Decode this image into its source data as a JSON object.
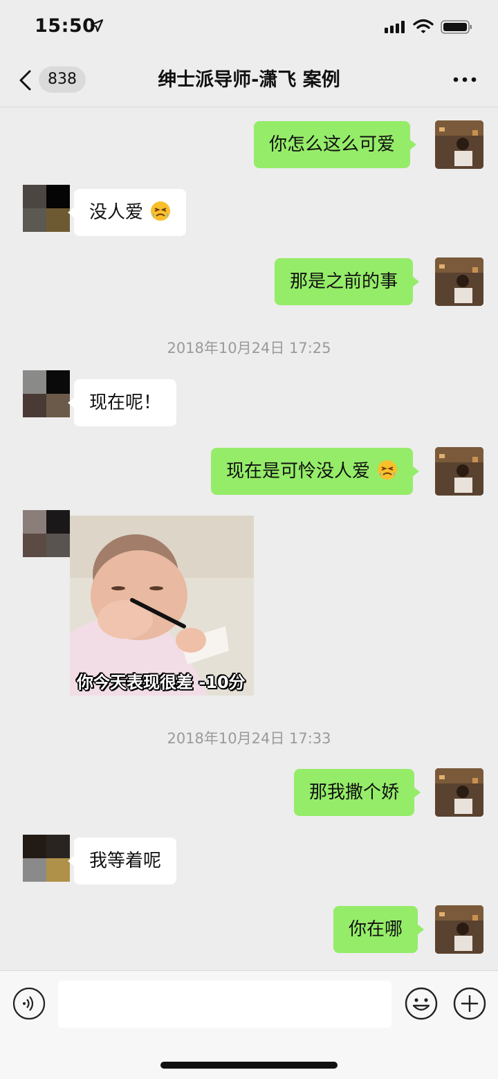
{
  "status_bar": {
    "time": "15:50"
  },
  "header": {
    "back_count": "838",
    "title": "绅士派导师-潇飞 案例"
  },
  "messages": [
    {
      "type": "text",
      "from": "me",
      "text": "你怎么这么可爱"
    },
    {
      "type": "text",
      "from": "other",
      "text": "没人爱",
      "emoji": "crying-face"
    },
    {
      "type": "text",
      "from": "me",
      "text": "那是之前的事"
    },
    {
      "type": "time",
      "text": "2018年10月24日 17:25"
    },
    {
      "type": "text",
      "from": "other",
      "text": "现在呢！"
    },
    {
      "type": "text",
      "from": "me",
      "text": "现在是可怜没人爱",
      "emoji": "crying-face"
    },
    {
      "type": "sticker",
      "from": "other",
      "caption": "你今天表现很差 -10分"
    },
    {
      "type": "time",
      "text": "2018年10月24日 17:33"
    },
    {
      "type": "text",
      "from": "me",
      "text": "那我撒个娇"
    },
    {
      "type": "text",
      "from": "other",
      "text": "我等着呢"
    },
    {
      "type": "text",
      "from": "me",
      "text": "你在哪"
    }
  ],
  "input_bar": {
    "value": "",
    "placeholder": ""
  },
  "icons": [
    "back-arrow-icon",
    "location-arrow-icon",
    "signal-icon",
    "wifi-icon",
    "battery-icon",
    "more-icon",
    "voice-icon",
    "emoji-icon",
    "plus-icon",
    "crying-face-icon"
  ],
  "colors": {
    "background": "#ededed",
    "my_bubble": "#95ec69",
    "their_bubble": "#ffffff",
    "timestamp": "#9a9a9a"
  }
}
